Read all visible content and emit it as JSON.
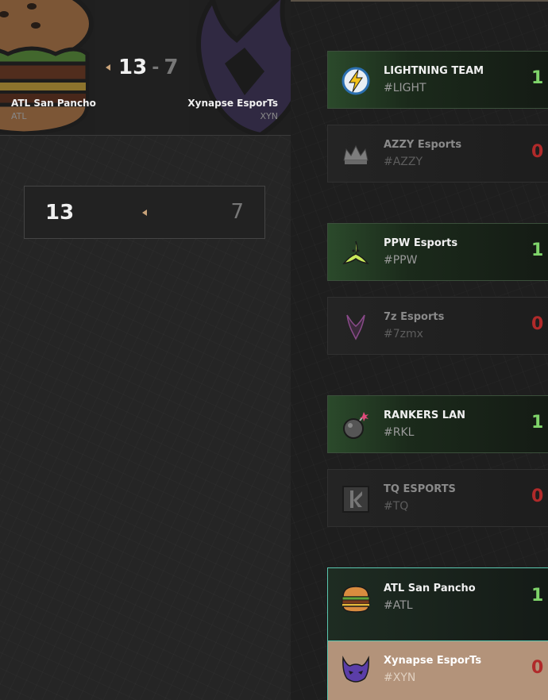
{
  "match": {
    "left_team": {
      "name": "ATL San Pancho",
      "tag": "ATL",
      "score": "13"
    },
    "right_team": {
      "name": "Xynapse EsporTs",
      "tag": "XYN",
      "score": "7"
    },
    "dash": "-"
  },
  "scorebox": {
    "left": "13",
    "right": "7"
  },
  "bracket": [
    {
      "name": "LIGHTNING TEAM",
      "tag": "#LIGHT",
      "points": "1",
      "icon": "lightning-icon"
    },
    {
      "name": "AZZY Esports",
      "tag": "#AZZY",
      "points": "0",
      "icon": "crown-icon"
    },
    {
      "name": "PPW Esports",
      "tag": "#PPW",
      "points": "1",
      "icon": "banana-icon"
    },
    {
      "name": "7z Esports",
      "tag": "#7zmx",
      "points": "0",
      "icon": "dragon-icon"
    },
    {
      "name": "RANKERS LAN",
      "tag": "#RKL",
      "points": "1",
      "icon": "bomb-icon"
    },
    {
      "name": "TQ ESPORTS",
      "tag": "#TQ",
      "points": "0",
      "icon": "tq-logo-icon"
    },
    {
      "name": "ATL San Pancho",
      "tag": "#ATL",
      "points": "1",
      "icon": "burger-icon"
    },
    {
      "name": "Xynapse EsporTs",
      "tag": "#XYN",
      "points": "0",
      "icon": "demon-icon"
    }
  ],
  "colors": {
    "win_green": "#7fd46a",
    "lose_red": "#b02a2a",
    "accent_tan": "#c9a37a",
    "highlight_teal": "#5ac7b0"
  }
}
